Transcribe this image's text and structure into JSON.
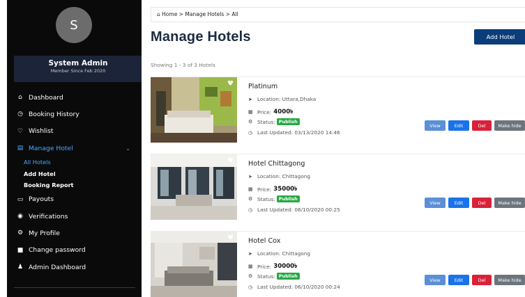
{
  "user": {
    "initial": "S",
    "name": "System Admin",
    "since": "Member Since Feb 2020"
  },
  "nav": {
    "dashboard": "Dashboard",
    "booking_history": "Booking History",
    "wishlist": "Wishlist",
    "manage_hotel": "Manage Hotel",
    "sub": {
      "all_hotels": "All Hotels",
      "add_hotel": "Add Hotel",
      "booking_report": "Booking Report"
    },
    "payouts": "Payouts",
    "verifications": "Verifications",
    "my_profile": "My Profile",
    "change_password": "Change password",
    "admin_dashboard": "Admin Dashboard"
  },
  "breadcrumb": {
    "icon": "home-icon",
    "text": "Home > Manage Hotels > All"
  },
  "page": {
    "title": "Manage Hotels",
    "add_button": "Add Hotel",
    "showing": "Showing 1 - 3 of 3 Hotels"
  },
  "labels": {
    "location": "Location:",
    "price": "Price:",
    "status": "Status:",
    "last_updated": "Last Updated:",
    "view": "View",
    "edit": "Edit",
    "del": "Del",
    "make_hide": "Make hide"
  },
  "hotels": [
    {
      "name": "Platinum",
      "location": "Uttara,Dhaka",
      "price": "4000৳",
      "status": "Publish",
      "updated": "03/13/2020 14:46"
    },
    {
      "name": "Hotel Chittagong",
      "location": "Chittagong",
      "price": "35000৳",
      "status": "Publish",
      "updated": "06/10/2020 00:25"
    },
    {
      "name": "Hotel Cox",
      "location": "Chittagong",
      "price": "30000৳",
      "status": "Publish",
      "updated": "06/10/2020 00:24"
    }
  ],
  "colors": {
    "sidebar_bg": "#0a0a0a",
    "accent": "#4aa8ff",
    "primary": "#0a3d7a",
    "publish": "#27a844",
    "danger": "#d9213a"
  }
}
